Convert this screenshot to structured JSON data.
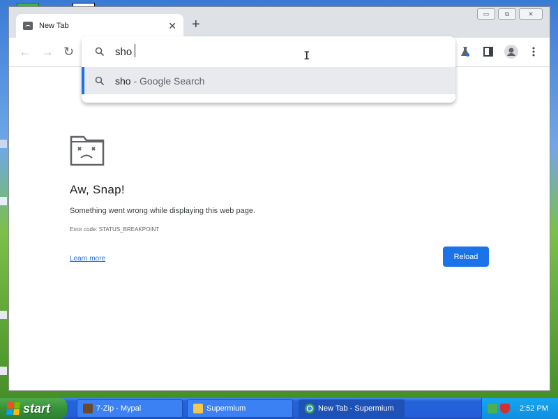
{
  "browser": {
    "tab": {
      "title": "New Tab",
      "close": "✕"
    },
    "new_tab": "+",
    "window_controls": {
      "minimize": "▭",
      "restore": "⧉",
      "close": "✕"
    },
    "nav": {
      "back": "←",
      "forward": "→",
      "reload": "↻"
    }
  },
  "omnibox": {
    "query": "sho",
    "suggestion": {
      "query": "sho",
      "suffix": " - Google Search"
    }
  },
  "error_page": {
    "title": "Aw, Snap!",
    "description": "Something went wrong while displaying this web page.",
    "error_code": "Error code: STATUS_BREAKPOINT",
    "learn_more": "Learn more",
    "reload": "Reload"
  },
  "taskbar": {
    "start": "start",
    "items": [
      {
        "label": "7-Zip - Mypal",
        "icon": "7zip-icon"
      },
      {
        "label": "Supermium",
        "icon": "folder-icon"
      },
      {
        "label": "New Tab - Supermium",
        "icon": "chrome-icon"
      }
    ],
    "clock": "2:52 PM"
  },
  "colors": {
    "accent": "#1a73e8",
    "taskbar": "#245edb",
    "start": "#37913a",
    "tray": "#0f8ee0"
  }
}
